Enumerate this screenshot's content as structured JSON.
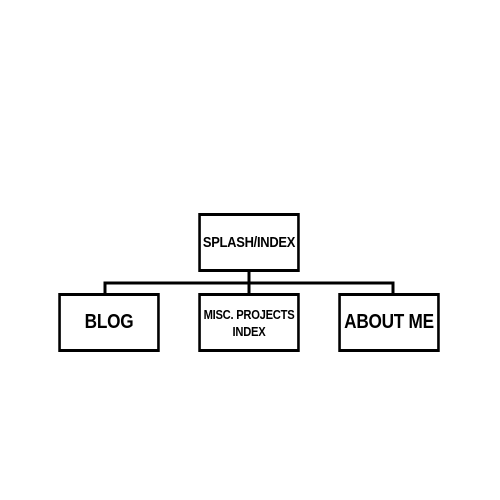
{
  "diagram": {
    "type": "hierarchy",
    "root": {
      "label": "SPLASH/INDEX"
    },
    "children": [
      {
        "label": "BLOG"
      },
      {
        "label": "MISC. PROJECTS\nINDEX"
      },
      {
        "label": "ABOUT ME"
      }
    ],
    "colors": {
      "stroke": "#000000",
      "background": "#ffffff",
      "text": "#000000"
    }
  }
}
